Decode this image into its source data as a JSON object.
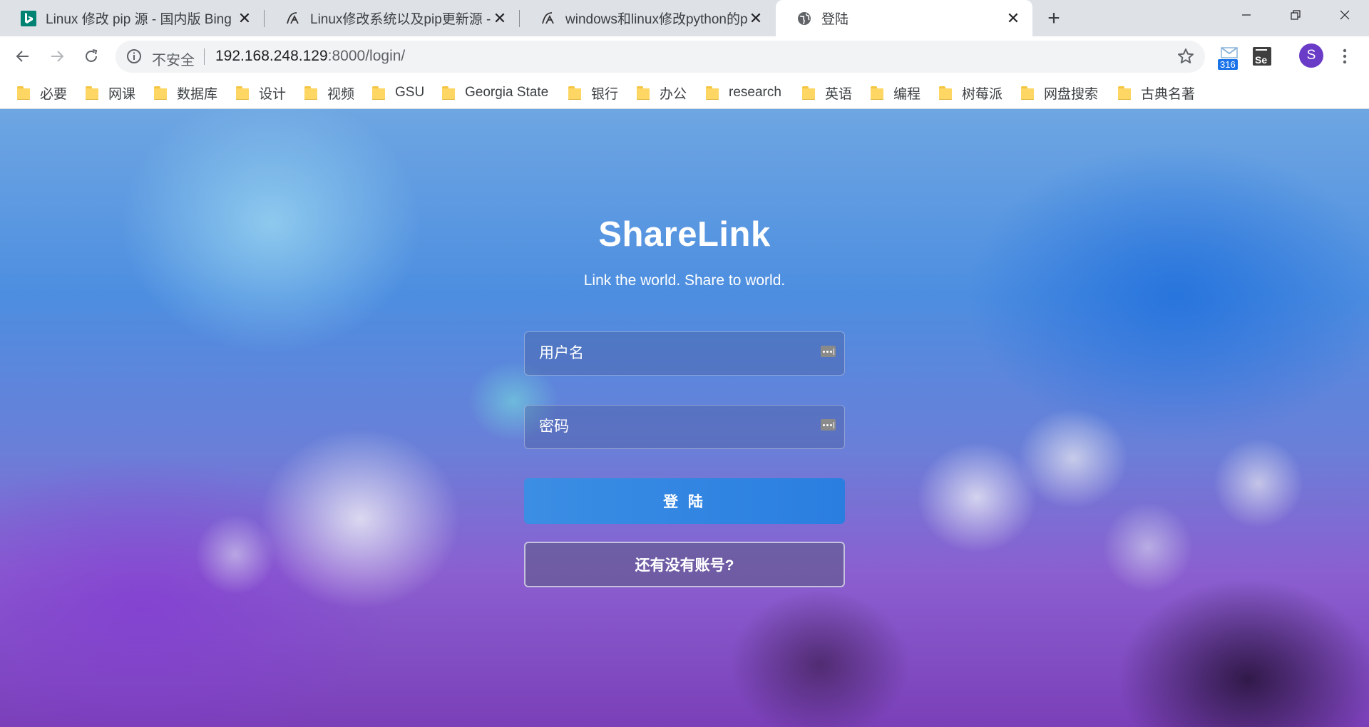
{
  "browser": {
    "tabs": [
      {
        "title": "Linux 修改 pip 源 - 国内版 Bing",
        "icon": "bing-icon"
      },
      {
        "title": "Linux修改系统以及pip更新源 - I",
        "icon": "site-icon"
      },
      {
        "title": "windows和linux修改python的p",
        "icon": "site-icon"
      },
      {
        "title": "登陆",
        "icon": "globe-icon"
      }
    ],
    "active_tab": 3
  },
  "toolbar": {
    "security_label": "不安全",
    "url_host": "192.168.248.129",
    "url_path": ":8000/login/",
    "extension_badge": "316",
    "selenium_label": "Se",
    "profile_initial": "S"
  },
  "bookmarks": [
    "必要",
    "网课",
    "数据库",
    "设计",
    "视频",
    "GSU",
    "Georgia State",
    "银行",
    "办公",
    "research",
    "英语",
    "编程",
    "树莓派",
    "网盘搜索",
    "古典名著"
  ],
  "page": {
    "title": "ShareLink",
    "subtitle": "Link the world. Share to world.",
    "username_placeholder": "用户名",
    "password_placeholder": "密码",
    "login_button": "登 陆",
    "register_button": "还有没有账号?"
  },
  "colors": {
    "accent": "#2a7ee0",
    "tab_strip": "#dee1e6",
    "avatar": "#6a3bc7"
  }
}
